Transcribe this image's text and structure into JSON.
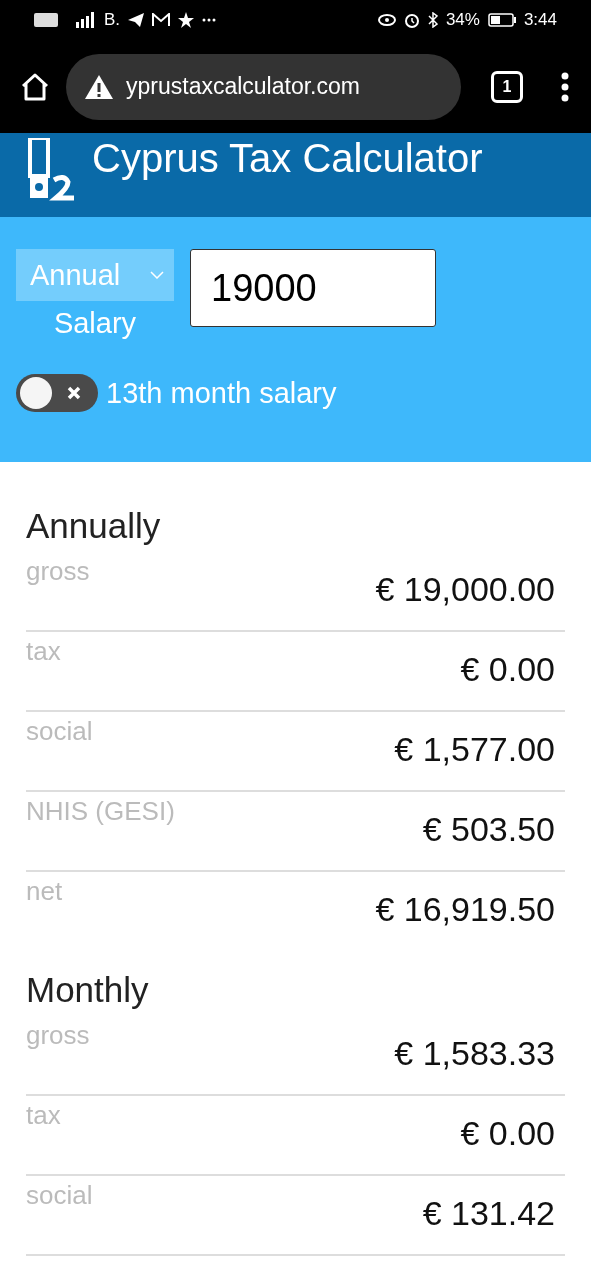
{
  "status_bar": {
    "carrier": "B.",
    "battery": "34%",
    "time": "3:44"
  },
  "browser": {
    "url": "yprustaxcalculator.com",
    "tab_count": "1"
  },
  "header": {
    "title": "Cyprus Tax Calculator"
  },
  "form": {
    "period": "Annual",
    "period_label": "Salary",
    "amount": "19000",
    "toggle": {
      "label": "13th month salary",
      "on": false
    }
  },
  "sections": [
    {
      "title": "Annually",
      "rows": [
        {
          "label": "gross",
          "value": "€ 19,000.00"
        },
        {
          "label": "tax",
          "value": "€ 0.00"
        },
        {
          "label": "social",
          "value": "€ 1,577.00"
        },
        {
          "label": "NHIS (GESI)",
          "value": "€ 503.50"
        },
        {
          "label": "net",
          "value": "€ 16,919.50"
        }
      ]
    },
    {
      "title": "Monthly",
      "rows": [
        {
          "label": "gross",
          "value": "€ 1,583.33"
        },
        {
          "label": "tax",
          "value": "€ 0.00"
        },
        {
          "label": "social",
          "value": "€ 131.42"
        }
      ]
    }
  ]
}
